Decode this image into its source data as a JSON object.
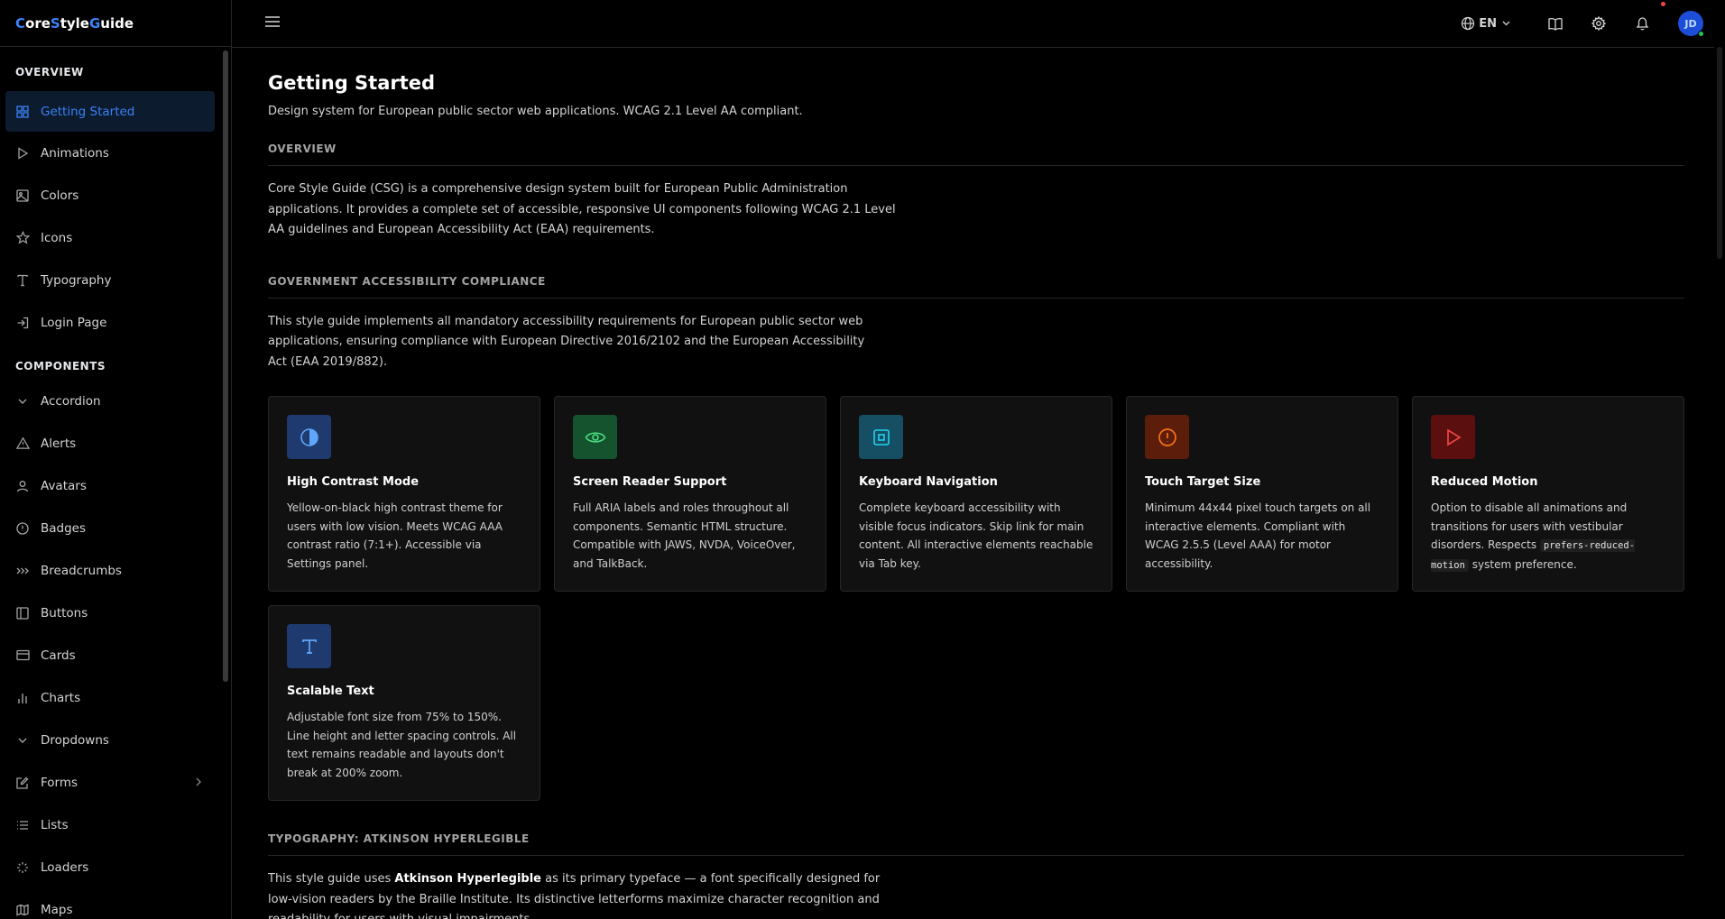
{
  "brand": {
    "c1": "C",
    "t1": "ore ",
    "c2": "S",
    "t2": "tyle ",
    "c3": "G",
    "t3": "uide"
  },
  "sidebar": {
    "overview_title": "OVERVIEW",
    "overview_items": [
      {
        "label": "Getting Started",
        "icon": "grid-icon",
        "active": true
      },
      {
        "label": "Animations",
        "icon": "play-icon"
      },
      {
        "label": "Colors",
        "icon": "image-icon"
      },
      {
        "label": "Icons",
        "icon": "star-icon"
      },
      {
        "label": "Typography",
        "icon": "type-icon"
      },
      {
        "label": "Login Page",
        "icon": "login-icon"
      }
    ],
    "components_title": "COMPONENTS",
    "component_items": [
      {
        "label": "Accordion",
        "icon": "chevron-down-icon"
      },
      {
        "label": "Alerts",
        "icon": "warning-icon"
      },
      {
        "label": "Avatars",
        "icon": "user-icon"
      },
      {
        "label": "Badges",
        "icon": "info-circle-icon"
      },
      {
        "label": "Breadcrumbs",
        "icon": "breadcrumbs-icon"
      },
      {
        "label": "Buttons",
        "icon": "panel-icon"
      },
      {
        "label": "Cards",
        "icon": "card-icon"
      },
      {
        "label": "Charts",
        "icon": "bar-chart-icon"
      },
      {
        "label": "Dropdowns",
        "icon": "chevron-down-icon"
      },
      {
        "label": "Forms",
        "icon": "edit-icon",
        "expandable": true
      },
      {
        "label": "Lists",
        "icon": "list-icon"
      },
      {
        "label": "Loaders",
        "icon": "loader-icon"
      },
      {
        "label": "Maps",
        "icon": "map-icon"
      }
    ]
  },
  "header": {
    "language": "EN",
    "avatar_initials": "JD"
  },
  "main": {
    "title": "Getting Started",
    "subtitle": "Design system for European public sector web applications. WCAG 2.1 Level AA compliant.",
    "overview_heading": "OVERVIEW",
    "overview_text": "Core Style Guide (CSG) is a comprehensive design system built for European Public Administration applications. It provides a complete set of accessible, responsive UI components following WCAG 2.1 Level AA guidelines and European Accessibility Act (EAA) requirements.",
    "compliance_heading": "GOVERNMENT ACCESSIBILITY COMPLIANCE",
    "compliance_text": "This style guide implements all mandatory accessibility requirements for European public sector web applications, ensuring compliance with European Directive 2016/2102 and the European Accessibility Act (EAA 2019/882).",
    "cards": [
      {
        "title": "High Contrast Mode",
        "desc": "Yellow-on-black high contrast theme for users with low vision. Meets WCAG AAA contrast ratio (7:1+). Accessible via Settings panel.",
        "icon": "contrast-icon",
        "bg": "#1e3a6e",
        "fg": "#60a5fa"
      },
      {
        "title": "Screen Reader Support",
        "desc": "Full ARIA labels and roles throughout all components. Semantic HTML structure. Compatible with JAWS, NVDA, VoiceOver, and TalkBack.",
        "icon": "eye-icon",
        "bg": "#14532d",
        "fg": "#4ade80"
      },
      {
        "title": "Keyboard Navigation",
        "desc": "Complete keyboard accessibility with visible focus indicators. Skip link for main content. All interactive elements reachable via Tab key.",
        "icon": "focus-square-icon",
        "bg": "#164e63",
        "fg": "#22d3ee"
      },
      {
        "title": "Touch Target Size",
        "desc": "Minimum 44x44 pixel touch targets on all interactive elements. Compliant with WCAG 2.5.5 (Level AAA) for motor accessibility.",
        "icon": "alert-circle-icon",
        "bg": "#5c1d0a",
        "fg": "#f97316"
      },
      {
        "title": "Reduced Motion",
        "desc_before": "Option to disable all animations and transitions for users with vestibular disorders. Respects ",
        "desc_code": "prefers-reduced-motion",
        "desc_after": " system preference.",
        "icon": "play-icon",
        "bg": "#5c0f0f",
        "fg": "#ef4444"
      },
      {
        "title": "Scalable Text",
        "desc": "Adjustable font size from 75% to 150%. Line height and letter spacing controls. All text remains readable and layouts don't break at 200% zoom.",
        "icon": "type-icon",
        "bg": "#1e3a6e",
        "fg": "#60a5fa"
      }
    ],
    "typography_heading": "TYPOGRAPHY: ATKINSON HYPERLEGIBLE",
    "typography_text_1": "This style guide uses ",
    "typography_text_bold": "Atkinson Hyperlegible",
    "typography_text_2": " as its primary typeface — a font specifically designed for low-vision readers by the Braille Institute. Its distinctive letterforms maximize character recognition and readability for users with visual impairments."
  }
}
